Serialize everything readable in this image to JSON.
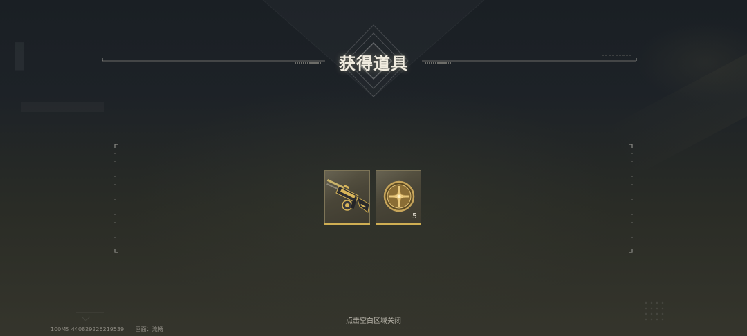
{
  "dialog": {
    "title": "获得道具",
    "close_hint": "点击空白区域关闭"
  },
  "items": [
    {
      "name": "gold machine gun",
      "icon": "machine-gun-icon",
      "count": ""
    },
    {
      "name": "gold medal token",
      "icon": "gold-medal-icon",
      "count": "5"
    }
  ],
  "footer": {
    "fps_uid": "100MS   4408292262195​39",
    "quality": "画面：流畅"
  },
  "colors": {
    "accent_gold": "#cfae53",
    "card_border": "#7d7457",
    "frame_line": "#8a8a85"
  }
}
